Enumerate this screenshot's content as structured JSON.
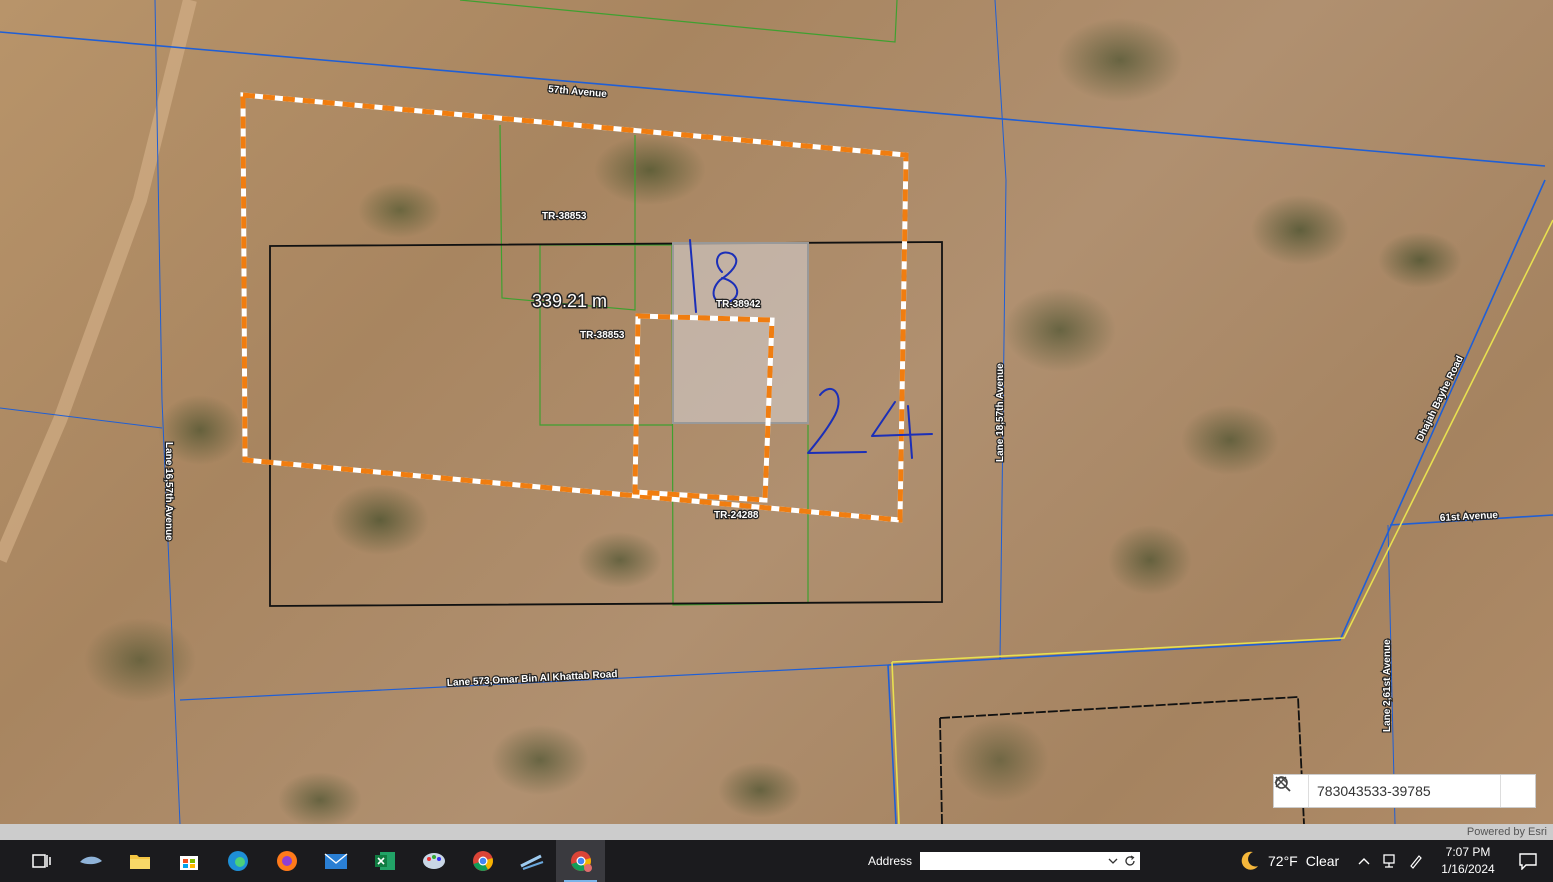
{
  "map": {
    "roads": {
      "avenue_57th": "57th Avenue",
      "lane_16_57th": "Lane 16,57th Avenue",
      "lane_18_57th": "Lane 18,57th Avenue",
      "lane_573": "Lane 573,Omar Bin Al Khattab Road",
      "dhajah_road": "Dhajah Bayhe Road",
      "avenue_61st": "61st Avenue",
      "lane_2_61st": "Lane 2,61st Avenue"
    },
    "parcels": {
      "p1": "TR-38853",
      "p2": "TR-38853",
      "p3": "TR-38942",
      "p4": "TR-24288"
    },
    "measurement": "339.21 m",
    "annotations": {
      "top": "18",
      "right": "24"
    }
  },
  "search": {
    "value": "783043533-39785"
  },
  "attribution": "Powered by Esri",
  "taskbar": {
    "address_label": "Address",
    "weather_temp": "72°F",
    "weather_condition": "Clear",
    "time": "7:07 PM",
    "date": "1/16/2024"
  }
}
